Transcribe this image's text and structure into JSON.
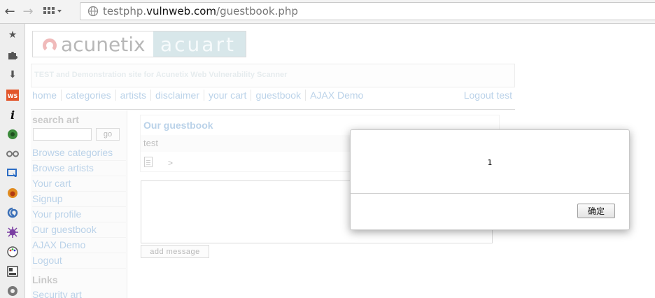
{
  "browser": {
    "url_domain_prefix": "testphp.",
    "url_domain_main": "vulnweb.com",
    "url_path": "/guestbook.php"
  },
  "site": {
    "logo_left": "acunetix",
    "logo_right": "acuart",
    "tagline": "TEST and Demonstration site for Acunetix Web Vulnerability Scanner",
    "nav": [
      "home",
      "categories",
      "artists",
      "disclaimer",
      "your cart",
      "guestbook",
      "AJAX Demo"
    ],
    "logout": "Logout test",
    "search_heading": "search art",
    "go_label": "go",
    "side_links": [
      "Browse categories",
      "Browse artists",
      "Your cart",
      "Signup",
      "Your profile",
      "Our guestbook",
      "AJAX Demo",
      "Logout"
    ],
    "links_heading": "Links",
    "links_first": "Security art"
  },
  "guestbook": {
    "title": "Our guestbook",
    "entry_author": "test",
    "entry_message": ">",
    "add_message_label": "add message"
  },
  "dialog": {
    "message": "1",
    "ok_label": "确定"
  }
}
